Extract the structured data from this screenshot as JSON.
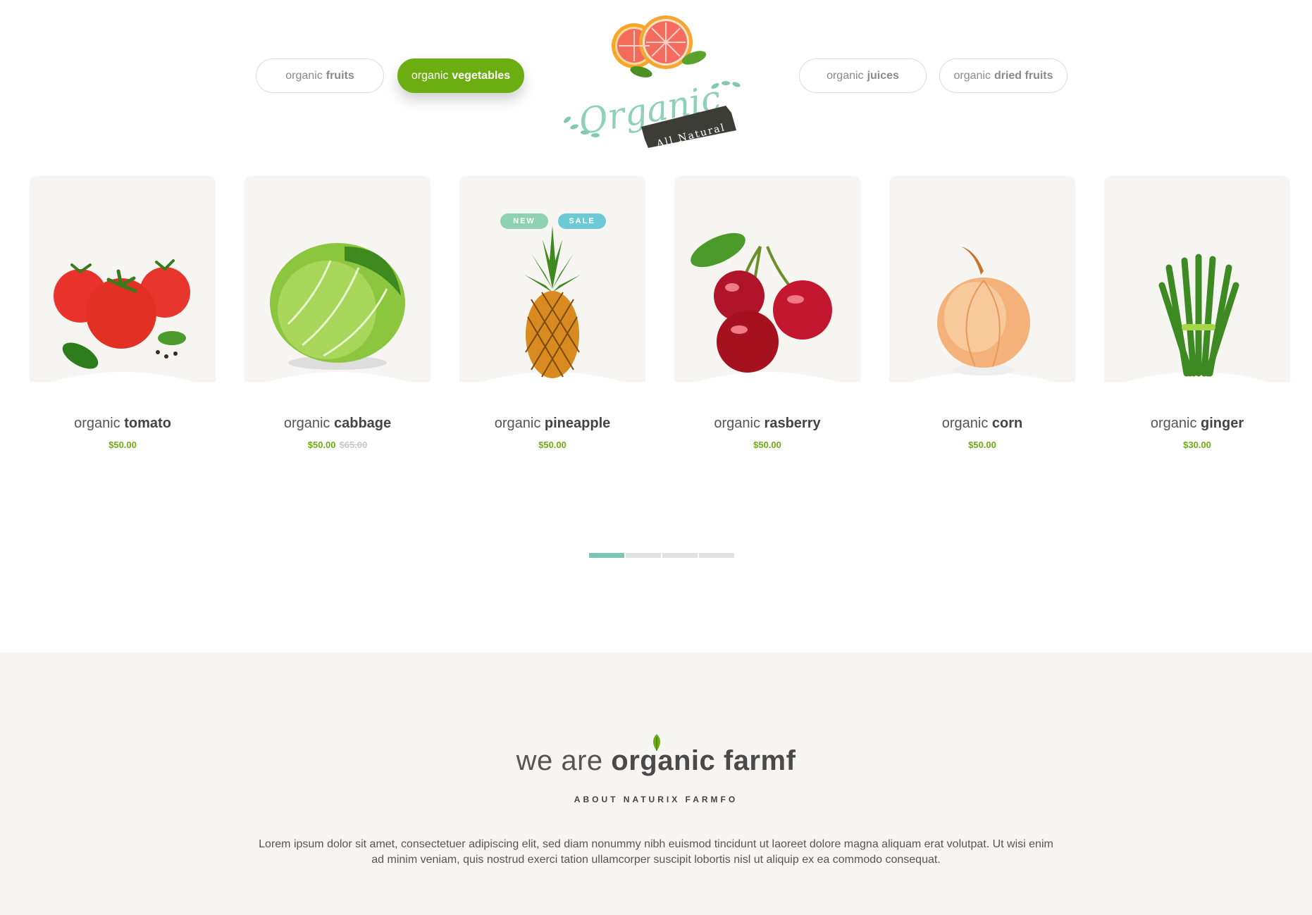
{
  "tabs": [
    {
      "prefix": "organic",
      "bold": "fruits",
      "active": false
    },
    {
      "prefix": "organic",
      "bold": "vegetables",
      "active": true
    },
    {
      "prefix": "organic",
      "bold": "juices",
      "active": false
    },
    {
      "prefix": "organic",
      "bold": "dried fruits",
      "active": false
    }
  ],
  "logo": {
    "script": "Organic",
    "ribbon": "All Natural"
  },
  "products": [
    {
      "prefix": "organic",
      "name": "tomato",
      "price": "$50.00",
      "old_price": "",
      "image": "tomato"
    },
    {
      "prefix": "organic",
      "name": "cabbage",
      "price": "$50.00",
      "old_price": "$65.00",
      "image": "cabbage"
    },
    {
      "prefix": "organic",
      "name": "pineapple",
      "price": "$50.00",
      "old_price": "",
      "image": "pineapple",
      "badges": [
        "NEW",
        "SALE"
      ]
    },
    {
      "prefix": "organic",
      "name": "rasberry",
      "price": "$50.00",
      "old_price": "",
      "image": "cherry"
    },
    {
      "prefix": "organic",
      "name": "corn",
      "price": "$50.00",
      "old_price": "",
      "image": "onion"
    },
    {
      "prefix": "organic",
      "name": "ginger",
      "price": "$30.00",
      "old_price": "",
      "image": "asparagus"
    }
  ],
  "pager": {
    "pages": 4,
    "current": 1
  },
  "about": {
    "title_light": "we are",
    "title_bold": "organic farmf",
    "subtitle": "ABOUT NATURIX FARMFO",
    "text": "Lorem ipsum dolor sit amet, consectetuer adipiscing elit, sed diam nonummy nibh euismod tincidunt ut laoreet dolore magna aliquam erat volutpat. Ut wisi enim ad minim veniam, quis nostrud exerci tation ullamcorper suscipit lobortis nisl ut aliquip ex ea commodo consequat."
  },
  "colors": {
    "accent": "#6cad12",
    "teal": "#79c7b4",
    "badge_new": "#8dd3b3",
    "badge_sale": "#6cc9d6",
    "section_bg": "#f6f5f2"
  }
}
